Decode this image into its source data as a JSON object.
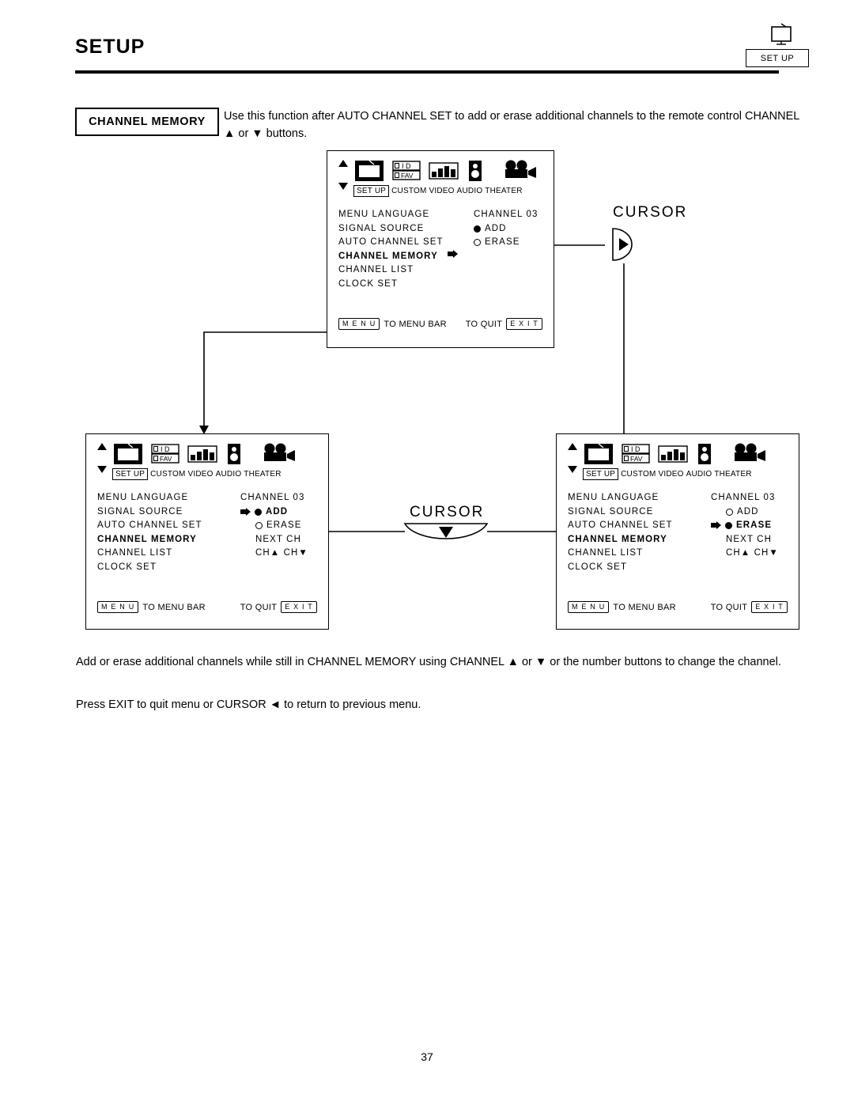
{
  "header": {
    "title": "SETUP",
    "corner_label": "SET UP",
    "corner_icon": "tv-icon"
  },
  "feature": {
    "badge": "CHANNEL MEMORY",
    "intro": "Use this function after AUTO CHANNEL SET to add or erase additional channels to the remote control CHANNEL ▲ or ▼ buttons."
  },
  "icon_bar": {
    "labels": [
      "SET UP",
      "CUSTOM",
      "VIDEO",
      "AUDIO",
      "THEATER"
    ],
    "icons": [
      "tv-setup-icon",
      "id-fav-custom-icon",
      "video-bars-icon",
      "audio-speaker-icon",
      "theater-projector-icon"
    ],
    "scroll_up_icon": "triangle-up-icon",
    "scroll_down_icon": "triangle-down-icon"
  },
  "menu_items": [
    "MENU LANGUAGE",
    "SIGNAL SOURCE",
    "AUTO CHANNEL SET",
    "CHANNEL MEMORY",
    "CHANNEL LIST",
    "CLOCK SET"
  ],
  "footer": {
    "menu_key": "M E N U",
    "menu_text": "TO MENU BAR",
    "quit_text": "TO QUIT",
    "exit_key": "E X I T"
  },
  "screen_top": {
    "channel_label": "CHANNEL  03",
    "add_label": "ADD",
    "erase_label": "ERASE",
    "add_state": "filled",
    "erase_state": "empty",
    "selected_item": "CHANNEL MEMORY",
    "cursor_on_menu": true
  },
  "screen_left": {
    "channel_label": "CHANNEL  03",
    "add_label": "ADD",
    "erase_label": "ERASE",
    "next_ch_label": "NEXT CH",
    "ch_updown_label": "CH▲ CH▼",
    "add_state": "filled",
    "erase_state": "empty",
    "selected_item": "CHANNEL MEMORY",
    "cursor_on_option": "ADD"
  },
  "screen_right": {
    "channel_label": "CHANNEL  03",
    "add_label": "ADD",
    "erase_label": "ERASE",
    "next_ch_label": "NEXT CH",
    "ch_updown_label": "CH▲ CH▼",
    "add_state": "empty",
    "erase_state": "filled",
    "selected_item": "CHANNEL MEMORY",
    "cursor_on_option": "ERASE"
  },
  "cursor_labels": {
    "top": "CURSOR",
    "middle": "CURSOR",
    "top_direction": "right",
    "middle_direction": "down"
  },
  "body_text": {
    "paragraph1": "Add or erase additional channels while still in CHANNEL MEMORY using CHANNEL ▲ or ▼ or the number buttons to change the channel.",
    "paragraph2": "Press EXIT to quit menu or CURSOR ◄ to return to previous menu."
  },
  "page_number": "37"
}
